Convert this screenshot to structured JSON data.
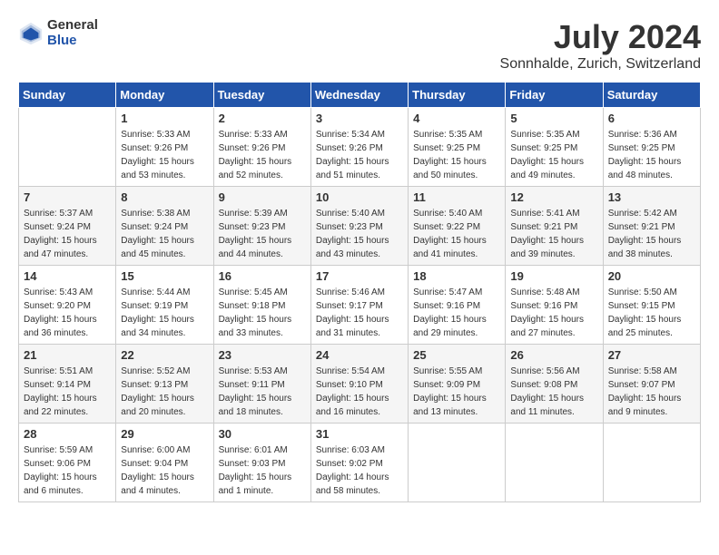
{
  "logo": {
    "general": "General",
    "blue": "Blue"
  },
  "title": "July 2024",
  "location": "Sonnhalde, Zurich, Switzerland",
  "weekdays": [
    "Sunday",
    "Monday",
    "Tuesday",
    "Wednesday",
    "Thursday",
    "Friday",
    "Saturday"
  ],
  "weeks": [
    [
      {
        "day": "",
        "sunrise": "",
        "sunset": "",
        "daylight": ""
      },
      {
        "day": "1",
        "sunrise": "Sunrise: 5:33 AM",
        "sunset": "Sunset: 9:26 PM",
        "daylight": "Daylight: 15 hours and 53 minutes."
      },
      {
        "day": "2",
        "sunrise": "Sunrise: 5:33 AM",
        "sunset": "Sunset: 9:26 PM",
        "daylight": "Daylight: 15 hours and 52 minutes."
      },
      {
        "day": "3",
        "sunrise": "Sunrise: 5:34 AM",
        "sunset": "Sunset: 9:26 PM",
        "daylight": "Daylight: 15 hours and 51 minutes."
      },
      {
        "day": "4",
        "sunrise": "Sunrise: 5:35 AM",
        "sunset": "Sunset: 9:25 PM",
        "daylight": "Daylight: 15 hours and 50 minutes."
      },
      {
        "day": "5",
        "sunrise": "Sunrise: 5:35 AM",
        "sunset": "Sunset: 9:25 PM",
        "daylight": "Daylight: 15 hours and 49 minutes."
      },
      {
        "day": "6",
        "sunrise": "Sunrise: 5:36 AM",
        "sunset": "Sunset: 9:25 PM",
        "daylight": "Daylight: 15 hours and 48 minutes."
      }
    ],
    [
      {
        "day": "7",
        "sunrise": "Sunrise: 5:37 AM",
        "sunset": "Sunset: 9:24 PM",
        "daylight": "Daylight: 15 hours and 47 minutes."
      },
      {
        "day": "8",
        "sunrise": "Sunrise: 5:38 AM",
        "sunset": "Sunset: 9:24 PM",
        "daylight": "Daylight: 15 hours and 45 minutes."
      },
      {
        "day": "9",
        "sunrise": "Sunrise: 5:39 AM",
        "sunset": "Sunset: 9:23 PM",
        "daylight": "Daylight: 15 hours and 44 minutes."
      },
      {
        "day": "10",
        "sunrise": "Sunrise: 5:40 AM",
        "sunset": "Sunset: 9:23 PM",
        "daylight": "Daylight: 15 hours and 43 minutes."
      },
      {
        "day": "11",
        "sunrise": "Sunrise: 5:40 AM",
        "sunset": "Sunset: 9:22 PM",
        "daylight": "Daylight: 15 hours and 41 minutes."
      },
      {
        "day": "12",
        "sunrise": "Sunrise: 5:41 AM",
        "sunset": "Sunset: 9:21 PM",
        "daylight": "Daylight: 15 hours and 39 minutes."
      },
      {
        "day": "13",
        "sunrise": "Sunrise: 5:42 AM",
        "sunset": "Sunset: 9:21 PM",
        "daylight": "Daylight: 15 hours and 38 minutes."
      }
    ],
    [
      {
        "day": "14",
        "sunrise": "Sunrise: 5:43 AM",
        "sunset": "Sunset: 9:20 PM",
        "daylight": "Daylight: 15 hours and 36 minutes."
      },
      {
        "day": "15",
        "sunrise": "Sunrise: 5:44 AM",
        "sunset": "Sunset: 9:19 PM",
        "daylight": "Daylight: 15 hours and 34 minutes."
      },
      {
        "day": "16",
        "sunrise": "Sunrise: 5:45 AM",
        "sunset": "Sunset: 9:18 PM",
        "daylight": "Daylight: 15 hours and 33 minutes."
      },
      {
        "day": "17",
        "sunrise": "Sunrise: 5:46 AM",
        "sunset": "Sunset: 9:17 PM",
        "daylight": "Daylight: 15 hours and 31 minutes."
      },
      {
        "day": "18",
        "sunrise": "Sunrise: 5:47 AM",
        "sunset": "Sunset: 9:16 PM",
        "daylight": "Daylight: 15 hours and 29 minutes."
      },
      {
        "day": "19",
        "sunrise": "Sunrise: 5:48 AM",
        "sunset": "Sunset: 9:16 PM",
        "daylight": "Daylight: 15 hours and 27 minutes."
      },
      {
        "day": "20",
        "sunrise": "Sunrise: 5:50 AM",
        "sunset": "Sunset: 9:15 PM",
        "daylight": "Daylight: 15 hours and 25 minutes."
      }
    ],
    [
      {
        "day": "21",
        "sunrise": "Sunrise: 5:51 AM",
        "sunset": "Sunset: 9:14 PM",
        "daylight": "Daylight: 15 hours and 22 minutes."
      },
      {
        "day": "22",
        "sunrise": "Sunrise: 5:52 AM",
        "sunset": "Sunset: 9:13 PM",
        "daylight": "Daylight: 15 hours and 20 minutes."
      },
      {
        "day": "23",
        "sunrise": "Sunrise: 5:53 AM",
        "sunset": "Sunset: 9:11 PM",
        "daylight": "Daylight: 15 hours and 18 minutes."
      },
      {
        "day": "24",
        "sunrise": "Sunrise: 5:54 AM",
        "sunset": "Sunset: 9:10 PM",
        "daylight": "Daylight: 15 hours and 16 minutes."
      },
      {
        "day": "25",
        "sunrise": "Sunrise: 5:55 AM",
        "sunset": "Sunset: 9:09 PM",
        "daylight": "Daylight: 15 hours and 13 minutes."
      },
      {
        "day": "26",
        "sunrise": "Sunrise: 5:56 AM",
        "sunset": "Sunset: 9:08 PM",
        "daylight": "Daylight: 15 hours and 11 minutes."
      },
      {
        "day": "27",
        "sunrise": "Sunrise: 5:58 AM",
        "sunset": "Sunset: 9:07 PM",
        "daylight": "Daylight: 15 hours and 9 minutes."
      }
    ],
    [
      {
        "day": "28",
        "sunrise": "Sunrise: 5:59 AM",
        "sunset": "Sunset: 9:06 PM",
        "daylight": "Daylight: 15 hours and 6 minutes."
      },
      {
        "day": "29",
        "sunrise": "Sunrise: 6:00 AM",
        "sunset": "Sunset: 9:04 PM",
        "daylight": "Daylight: 15 hours and 4 minutes."
      },
      {
        "day": "30",
        "sunrise": "Sunrise: 6:01 AM",
        "sunset": "Sunset: 9:03 PM",
        "daylight": "Daylight: 15 hours and 1 minute."
      },
      {
        "day": "31",
        "sunrise": "Sunrise: 6:03 AM",
        "sunset": "Sunset: 9:02 PM",
        "daylight": "Daylight: 14 hours and 58 minutes."
      },
      {
        "day": "",
        "sunrise": "",
        "sunset": "",
        "daylight": ""
      },
      {
        "day": "",
        "sunrise": "",
        "sunset": "",
        "daylight": ""
      },
      {
        "day": "",
        "sunrise": "",
        "sunset": "",
        "daylight": ""
      }
    ]
  ]
}
